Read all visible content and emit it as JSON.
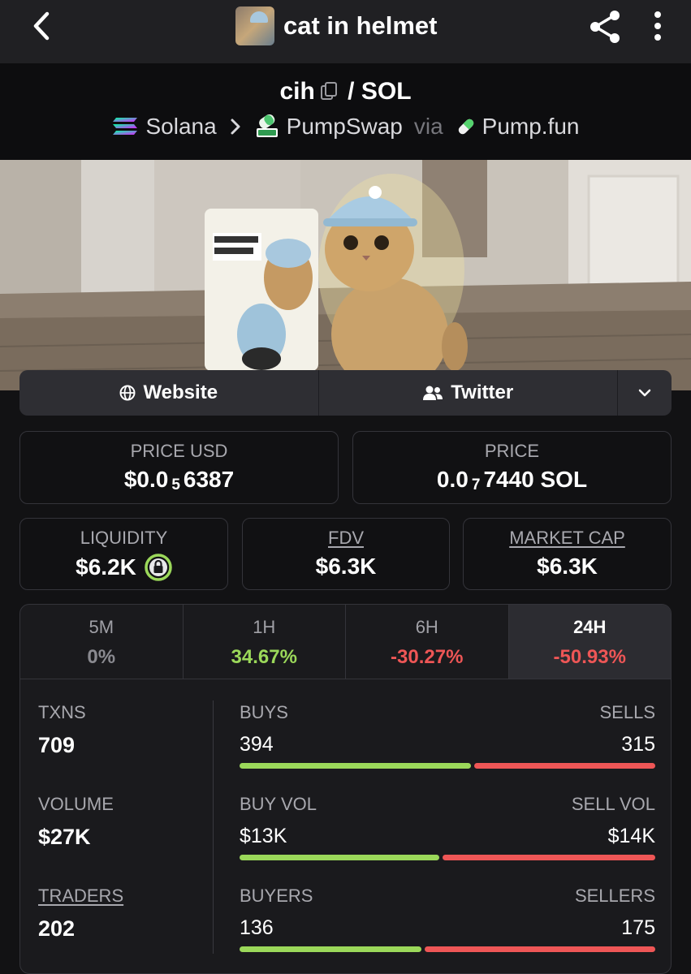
{
  "header": {
    "title": "cat in helmet",
    "back_icon": "chevron-left-icon",
    "share_icon": "share-icon",
    "more_icon": "more-vertical-icon"
  },
  "pair": {
    "base": "cih",
    "separator": "/",
    "quote": "SOL",
    "chain": "Solana",
    "dex": "PumpSwap",
    "via": "via",
    "launchpad": "Pump.fun"
  },
  "links": {
    "website": "Website",
    "twitter": "Twitter"
  },
  "prices": {
    "usd_label": "PRICE USD",
    "usd_prefix": "$0.0",
    "usd_zeros": "5",
    "usd_digits": "6387",
    "native_label": "PRICE",
    "native_prefix": "0.0",
    "native_zeros": "7",
    "native_digits": "7440 SOL"
  },
  "market": {
    "liquidity_label": "LIQUIDITY",
    "liquidity_value": "$6.2K",
    "fdv_label": "FDV",
    "fdv_value": "$6.3K",
    "mcap_label": "MARKET CAP",
    "mcap_value": "$6.3K"
  },
  "timeframes": [
    {
      "label": "5M",
      "change": "0%",
      "color": "#8a8a90"
    },
    {
      "label": "1H",
      "change": "34.67%",
      "color": "#9bd85a"
    },
    {
      "label": "6H",
      "change": "-30.27%",
      "color": "#ee5656"
    },
    {
      "label": "24H",
      "change": "-50.93%",
      "color": "#ee5656"
    }
  ],
  "stats": {
    "txns_label": "TXNS",
    "txns": "709",
    "volume_label": "VOLUME",
    "volume": "$27K",
    "traders_label": "TRADERS",
    "traders": "202",
    "buys_label": "BUYS",
    "buys": "394",
    "sells_label": "SELLS",
    "sells": "315",
    "buy_vol_label": "BUY VOL",
    "buy_vol": "$13K",
    "sell_vol_label": "SELL VOL",
    "sell_vol": "$14K",
    "buyers_label": "BUYERS",
    "buyers": "136",
    "sellers_label": "SELLERS",
    "sellers": "175",
    "buy_share": 0.556,
    "buy_vol_share": 0.481,
    "buyer_share": 0.437
  },
  "colors": {
    "green": "#9bd85a",
    "red": "#ee5656"
  }
}
